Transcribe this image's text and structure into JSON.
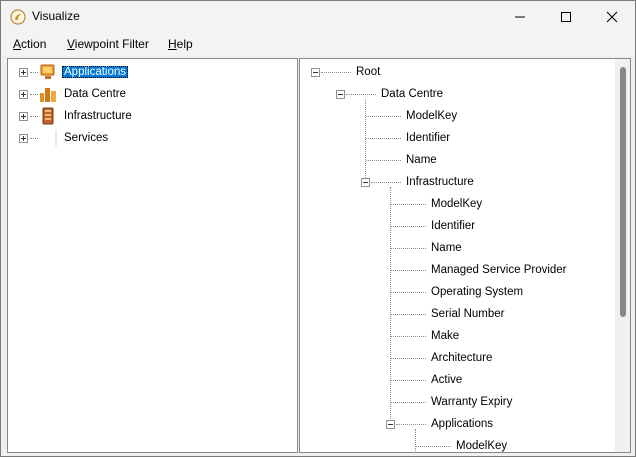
{
  "window": {
    "title": "Visualize",
    "icon": "app-logo-icon"
  },
  "menu": [
    {
      "label": "Action",
      "accel": "A",
      "rest": "ction"
    },
    {
      "label": "Viewpoint Filter",
      "accel": "V",
      "rest": "iewpoint Filter"
    },
    {
      "label": "Help",
      "accel": "H",
      "rest": "elp"
    }
  ],
  "left_tree": [
    {
      "label": "Applications",
      "icon": "applications-icon",
      "selected": true,
      "expander": "plus"
    },
    {
      "label": "Data Centre",
      "icon": "data-centre-icon",
      "selected": false,
      "expander": "plus"
    },
    {
      "label": "Infrastructure",
      "icon": "infrastructure-icon",
      "selected": false,
      "expander": "plus"
    },
    {
      "label": "Services",
      "icon": "services-icon",
      "selected": false,
      "expander": "plus"
    }
  ],
  "right_tree": [
    {
      "label": "Root",
      "level": 0,
      "expander": "minus"
    },
    {
      "label": "Data Centre",
      "level": 1,
      "expander": "minus"
    },
    {
      "label": "ModelKey",
      "level": 2
    },
    {
      "label": "Identifier",
      "level": 2
    },
    {
      "label": "Name",
      "level": 2
    },
    {
      "label": "Infrastructure",
      "level": 2,
      "expander": "minus"
    },
    {
      "label": "ModelKey",
      "level": 3
    },
    {
      "label": "Identifier",
      "level": 3
    },
    {
      "label": "Name",
      "level": 3
    },
    {
      "label": "Managed Service Provider",
      "level": 3
    },
    {
      "label": "Operating System",
      "level": 3
    },
    {
      "label": "Serial Number",
      "level": 3
    },
    {
      "label": "Make",
      "level": 3
    },
    {
      "label": "Architecture",
      "level": 3
    },
    {
      "label": "Active",
      "level": 3
    },
    {
      "label": "Warranty Expiry",
      "level": 3
    },
    {
      "label": "Applications",
      "level": 3,
      "expander": "minus"
    },
    {
      "label": "ModelKey",
      "level": 4
    }
  ],
  "colors": {
    "selection": "#0078d7",
    "window_bg": "#f3f3f3"
  }
}
